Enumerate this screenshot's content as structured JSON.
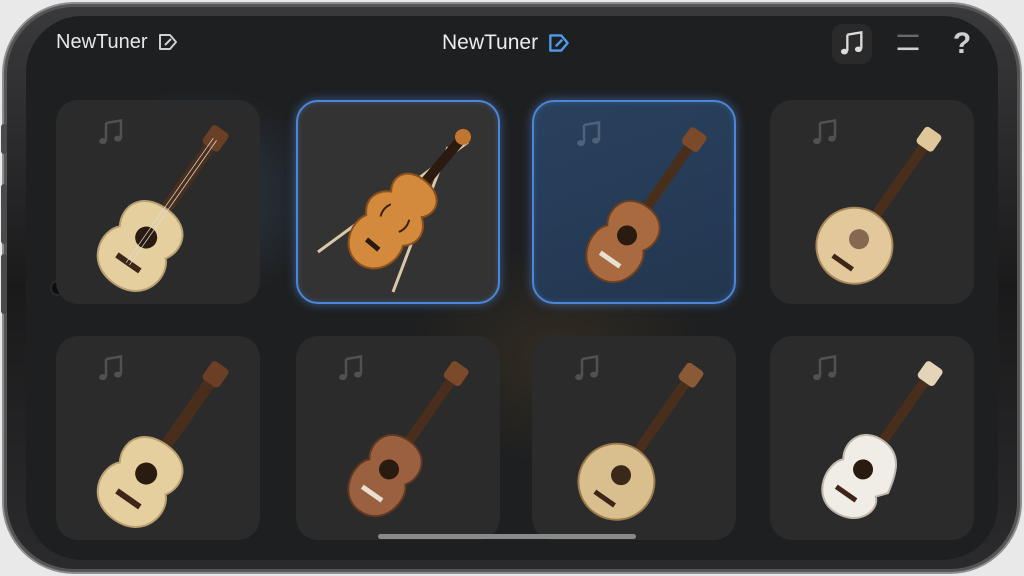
{
  "app": {
    "title_left": "NewTuner",
    "title_center": "NewTuner",
    "accent": "#4d86d8"
  },
  "header": {
    "left_icon": "edit-tag-icon",
    "center_icon": "edit-tag-icon",
    "actions": [
      {
        "name": "music-note-icon"
      },
      {
        "name": "menu-icon"
      },
      {
        "name": "help-icon",
        "glyph": "?"
      }
    ]
  },
  "instruments": [
    {
      "kind": "acoustic-guitar",
      "selected": false
    },
    {
      "kind": "violin",
      "selected": true
    },
    {
      "kind": "ukulele",
      "selected": true
    },
    {
      "kind": "banjo-ukulele",
      "selected": false
    },
    {
      "kind": "acoustic-guitar",
      "selected": false
    },
    {
      "kind": "ukulele",
      "selected": false
    },
    {
      "kind": "banjo-ukulele",
      "selected": false
    },
    {
      "kind": "electric-ukulele",
      "selected": false
    }
  ]
}
